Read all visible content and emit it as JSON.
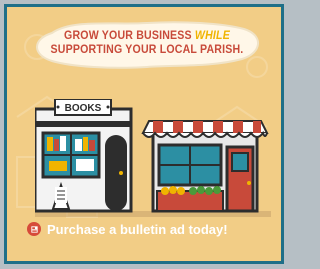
{
  "banner": {
    "line1_prefix": "GROW YOUR BUSINESS",
    "line1_accent": "WHILE",
    "line2": "SUPPORTING YOUR LOCAL PARISH."
  },
  "stores": {
    "books_sign": "BOOKS"
  },
  "cta": {
    "text": "Purchase a bulletin ad today!"
  },
  "colors": {
    "frame_border": "#1f6f88",
    "background": "#f2cd86",
    "banner_text": "#c84a3a",
    "accent": "#f0b400",
    "cta_icon": "#d64a3a"
  },
  "icons": {
    "cta_icon": "newspaper-icon"
  }
}
